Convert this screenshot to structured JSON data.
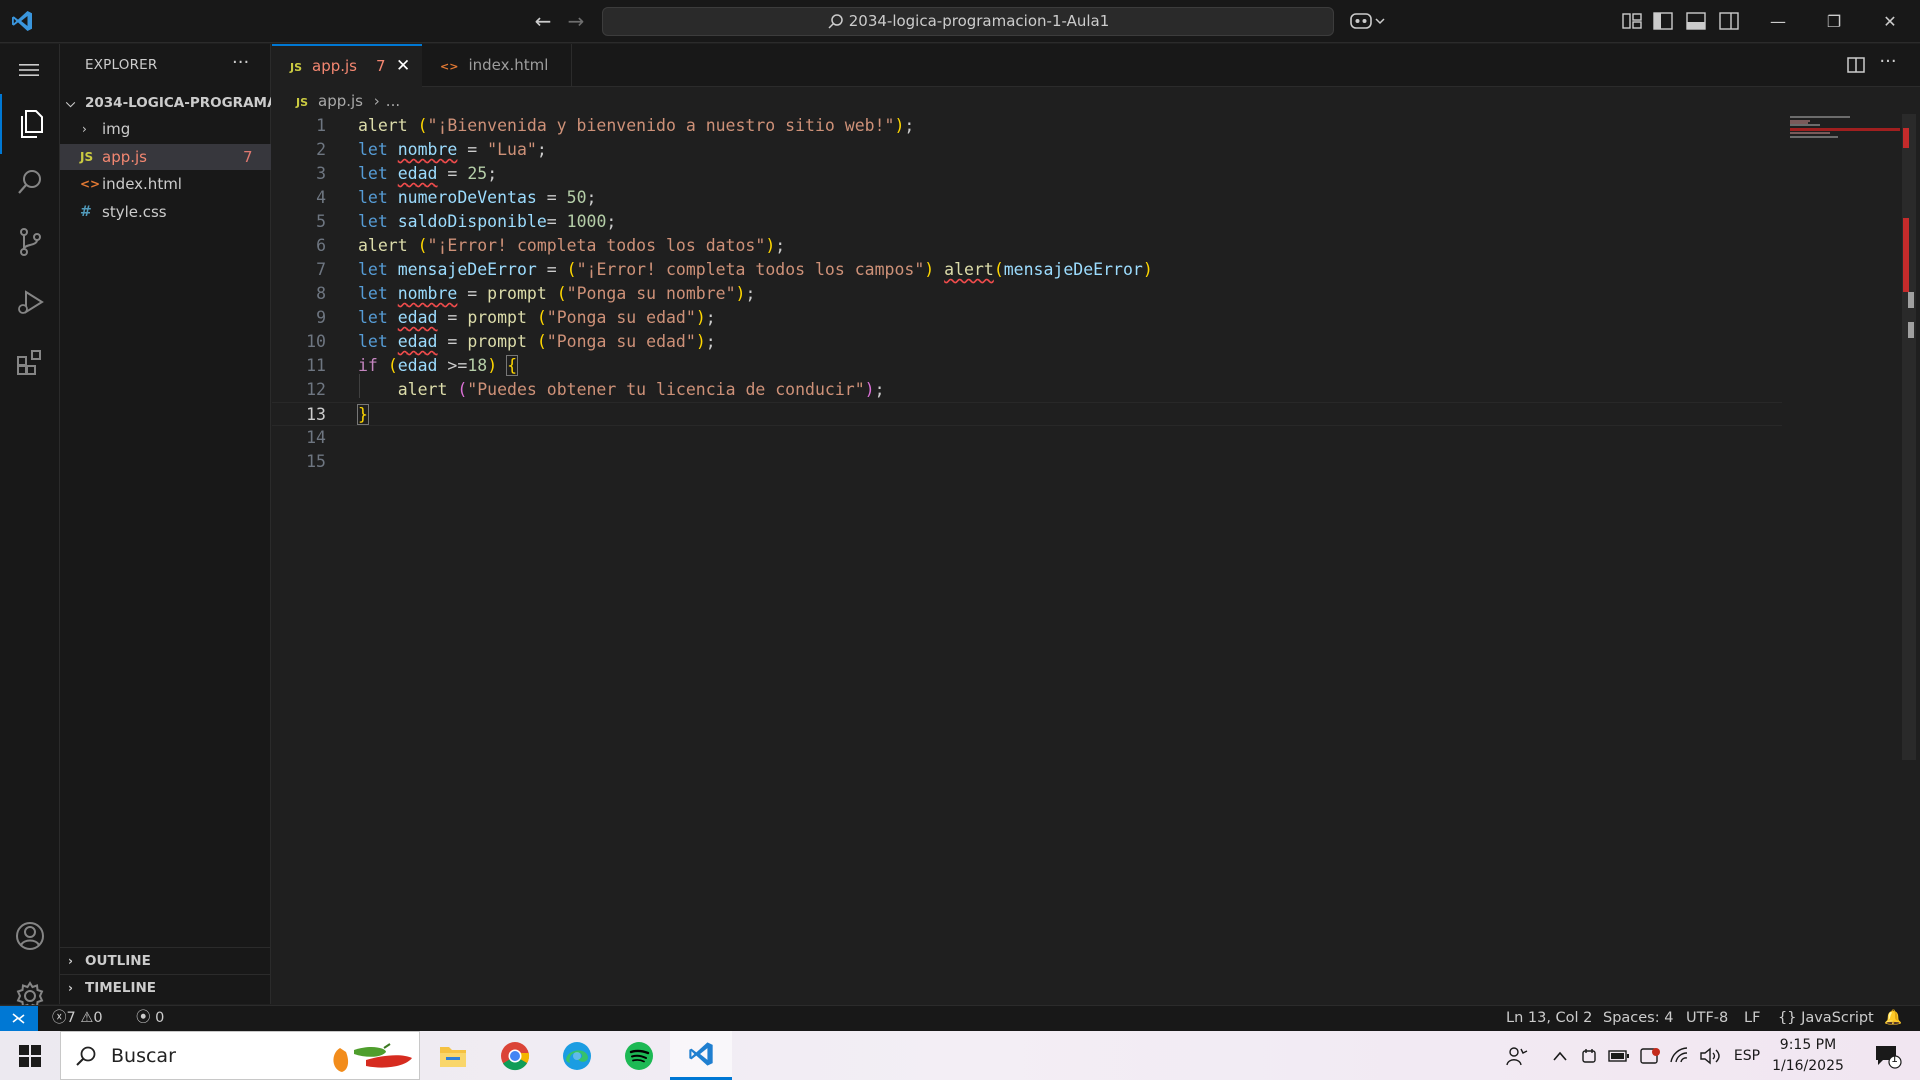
{
  "titlebar": {
    "search_text": "2034-logica-programacion-1-Aula1",
    "window_controls": [
      "minimize",
      "restore",
      "close"
    ]
  },
  "activity_bar": [
    "files-icon",
    "search-icon",
    "source-control-icon",
    "run-debug-icon",
    "extensions-icon",
    "account-icon",
    "settings-icon"
  ],
  "explorer": {
    "header": "EXPLORER",
    "more": "···",
    "folder": "2034-LOGICA-PROGRAMA...",
    "items": [
      {
        "label": "img",
        "type": "folder"
      },
      {
        "label": "app.js",
        "type": "js",
        "icon_text": "JS",
        "count": "7"
      },
      {
        "label": "index.html",
        "type": "html",
        "icon_text": "<>"
      },
      {
        "label": "style.css",
        "type": "css",
        "icon_text": "#"
      }
    ],
    "sections": [
      "OUTLINE",
      "TIMELINE"
    ]
  },
  "tabs": [
    {
      "label": "app.js",
      "icon_text": "JS",
      "count": "7",
      "active": true
    },
    {
      "label": "index.html",
      "icon_text": "<>",
      "active": false
    }
  ],
  "breadcrumb": {
    "icon_text": "JS",
    "file": "app.js",
    "rest": "..."
  },
  "editor": {
    "current_line": 13,
    "line_numbers": [
      "1",
      "2",
      "3",
      "4",
      "5",
      "6",
      "7",
      "8",
      "9",
      "10",
      "11",
      "12",
      "13",
      "14",
      "15"
    ]
  },
  "statusbar": {
    "errors": "7",
    "warnings": "0",
    "ports": "0",
    "position": "Ln 13, Col 2",
    "spaces": "Spaces: 4",
    "encoding": "UTF-8",
    "eol": "LF",
    "language": "JavaScript"
  },
  "taskbar": {
    "search_text": "Buscar",
    "lang": "ESP",
    "time": "9:15 PM",
    "date": "1/16/2025",
    "notification_count": "1"
  },
  "colors": {
    "accent": "#0078d4",
    "keyword": "#569cd6",
    "string": "#ce9178",
    "number": "#b5cea8",
    "function": "#dcdcaa",
    "variable": "#9cdcfe",
    "error": "#f14c4c"
  }
}
